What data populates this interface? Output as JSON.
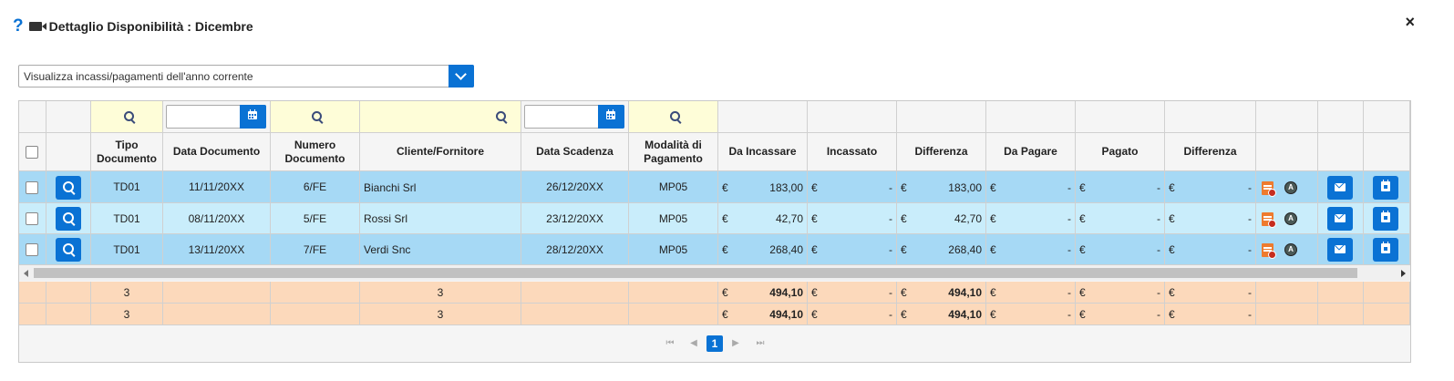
{
  "header": {
    "title": "Dettaglio Disponibilità : Dicembre",
    "close": "×"
  },
  "filter_select": {
    "value": "Visualizza incassi/pagamenti dell'anno corrente"
  },
  "columns": [
    "Tipo Documento",
    "Data Documento",
    "Numero Documento",
    "Cliente/Fornitore",
    "Data Scadenza",
    "Modalità di Pagamento",
    "Da Incassare",
    "Incassato",
    "Differenza",
    "Da Pagare",
    "Pagato",
    "Differenza"
  ],
  "currency": "€",
  "rows": [
    {
      "tipo": "TD01",
      "data_doc": "11/11/20XX",
      "numero": "6/FE",
      "cliente": "Bianchi Srl",
      "scadenza": "26/12/20XX",
      "modalita": "MP05",
      "da_incassare": "183,00",
      "incassato": "-",
      "differenza1": "183,00",
      "da_pagare": "-",
      "pagato": "-",
      "differenza2": "-"
    },
    {
      "tipo": "TD01",
      "data_doc": "08/11/20XX",
      "numero": "5/FE",
      "cliente": "Rossi Srl",
      "scadenza": "23/12/20XX",
      "modalita": "MP05",
      "da_incassare": "42,70",
      "incassato": "-",
      "differenza1": "42,70",
      "da_pagare": "-",
      "pagato": "-",
      "differenza2": "-"
    },
    {
      "tipo": "TD01",
      "data_doc": "13/11/20XX",
      "numero": "7/FE",
      "cliente": "Verdi Snc",
      "scadenza": "28/12/20XX",
      "modalita": "MP05",
      "da_incassare": "268,40",
      "incassato": "-",
      "differenza1": "268,40",
      "da_pagare": "-",
      "pagato": "-",
      "differenza2": "-"
    }
  ],
  "totals": [
    {
      "tipo": "3",
      "cliente": "3",
      "da_incassare": "494,10",
      "incassato": "-",
      "differenza1": "494,10",
      "da_pagare": "-",
      "pagato": "-",
      "differenza2": "-"
    },
    {
      "tipo": "3",
      "cliente": "3",
      "da_incassare": "494,10",
      "incassato": "-",
      "differenza1": "494,10",
      "da_pagare": "-",
      "pagato": "-",
      "differenza2": "-"
    }
  ],
  "pager": {
    "current_page": "1",
    "first": "⏮",
    "prev": "◀",
    "next": "▶",
    "last": "⏭"
  }
}
